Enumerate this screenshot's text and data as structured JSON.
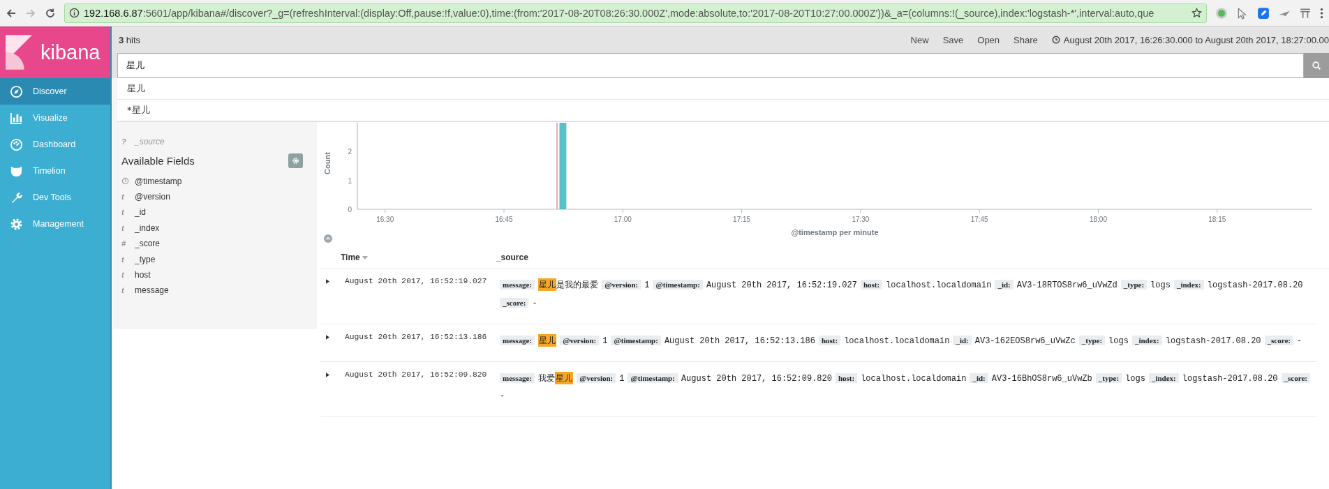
{
  "browser": {
    "url_host": "192.168.6.87",
    "url_rest": ":5601/app/kibana#/discover?_g=(refreshInterval:(display:Off,pause:!f,value:0),time:(from:'2017-08-20T08:26:30.000Z',mode:absolute,to:'2017-08-20T10:27:00.000Z'))&_a=(columns:!(_source),index:'logstash-*',interval:auto,que"
  },
  "sidebar": {
    "logo_text": "kibana",
    "items": [
      {
        "label": "Discover",
        "selected": true
      },
      {
        "label": "Visualize",
        "selected": false
      },
      {
        "label": "Dashboard",
        "selected": false
      },
      {
        "label": "Timelion",
        "selected": false
      },
      {
        "label": "Dev Tools",
        "selected": false
      },
      {
        "label": "Management",
        "selected": false
      }
    ]
  },
  "top_bar": {
    "hits": "**3** hits",
    "menu": [
      "New",
      "Save",
      "Open",
      "Share"
    ],
    "time_range": "August 20th 2017, 16:26:30.000 to August 20th 2017, 18:27:00.00"
  },
  "search": {
    "value": "星儿",
    "suggestions": [
      "星儿",
      "*星儿"
    ]
  },
  "fields": {
    "selected": [
      {
        "kind": "text",
        "glyph": "?",
        "name": "_source"
      }
    ],
    "available_title": "Available Fields",
    "available": [
      {
        "kind": "date",
        "name": "@timestamp"
      },
      {
        "kind": "text",
        "glyph": "t",
        "name": "@version"
      },
      {
        "kind": "text",
        "glyph": "t",
        "name": "_id"
      },
      {
        "kind": "text",
        "glyph": "t",
        "name": "_index"
      },
      {
        "kind": "text",
        "glyph": "#",
        "name": "_score"
      },
      {
        "kind": "text",
        "glyph": "t",
        "name": "_type"
      },
      {
        "kind": "text",
        "glyph": "t",
        "name": "host"
      },
      {
        "kind": "text",
        "glyph": "t",
        "name": "message"
      }
    ]
  },
  "chart": {
    "chart_data": {
      "type": "bar",
      "xlabel": "@timestamp per minute",
      "ylabel": "Count",
      "x": [
        1012
      ],
      "values": [
        3
      ],
      "xlim": [
        986.5,
        1107
      ],
      "ylim": [
        0,
        3
      ],
      "yticks": [
        0,
        1,
        2
      ],
      "xticks": [
        {
          "value": 990,
          "label": "16:30"
        },
        {
          "value": 1005,
          "label": "16:45"
        },
        {
          "value": 1020,
          "label": "17:00"
        },
        {
          "value": 1035,
          "label": "17:15"
        },
        {
          "value": 1050,
          "label": "17:30"
        },
        {
          "value": 1065,
          "label": "17:45"
        },
        {
          "value": 1080,
          "label": "18:00"
        },
        {
          "value": 1095,
          "label": "18:15"
        }
      ],
      "color": "#57c1c9",
      "ref_lines": [
        {
          "axis": "x",
          "value": 1011.7,
          "color": "#f0a8a8"
        }
      ]
    }
  },
  "table": {
    "columns": [
      "Time",
      "_source"
    ],
    "rows": [
      {
        "time": "August 20th 2017, 16:52:19.027",
        "fields": [
          {
            "key": "message:",
            "parts": [
              {
                "text": "星儿",
                "highlight": true
              },
              {
                "text": "是我的最爱",
                "highlight": false
              }
            ]
          },
          {
            "key": "@version:",
            "value": "1"
          },
          {
            "key": "@timestamp:",
            "value": "August 20th 2017, 16:52:19.027"
          },
          {
            "key": "host:",
            "value": "localhost.localdomain"
          },
          {
            "key": "_id:",
            "value": "AV3-18RTOS8rw6_uVwZd"
          },
          {
            "key": "_type:",
            "value": "logs"
          },
          {
            "key": "_index:",
            "value": "logstash-2017.08.20"
          },
          {
            "key": "_score:",
            "value": "-"
          }
        ]
      },
      {
        "time": "August 20th 2017, 16:52:13.186",
        "fields": [
          {
            "key": "message:",
            "parts": [
              {
                "text": "星儿",
                "highlight": true
              }
            ]
          },
          {
            "key": "@version:",
            "value": "1"
          },
          {
            "key": "@timestamp:",
            "value": "August 20th 2017, 16:52:13.186"
          },
          {
            "key": "host:",
            "value": "localhost.localdomain"
          },
          {
            "key": "_id:",
            "value": "AV3-162EOS8rw6_uVwZc"
          },
          {
            "key": "_type:",
            "value": "logs"
          },
          {
            "key": "_index:",
            "value": "logstash-2017.08.20"
          },
          {
            "key": "_score:",
            "value": "-"
          }
        ]
      },
      {
        "time": "August 20th 2017, 16:52:09.820",
        "fields": [
          {
            "key": "message:",
            "parts": [
              {
                "text": "我爱",
                "highlight": false
              },
              {
                "text": "星儿",
                "highlight": true
              }
            ]
          },
          {
            "key": "@version:",
            "value": "1"
          },
          {
            "key": "@timestamp:",
            "value": "August 20th 2017, 16:52:09.820"
          },
          {
            "key": "host:",
            "value": "localhost.localdomain"
          },
          {
            "key": "_id:",
            "value": "AV3-16BhOS8rw6_uVwZb"
          },
          {
            "key": "_type:",
            "value": "logs"
          },
          {
            "key": "_index:",
            "value": "logstash-2017.08.20"
          },
          {
            "key": "_score:",
            "value": "-"
          }
        ]
      }
    ]
  }
}
